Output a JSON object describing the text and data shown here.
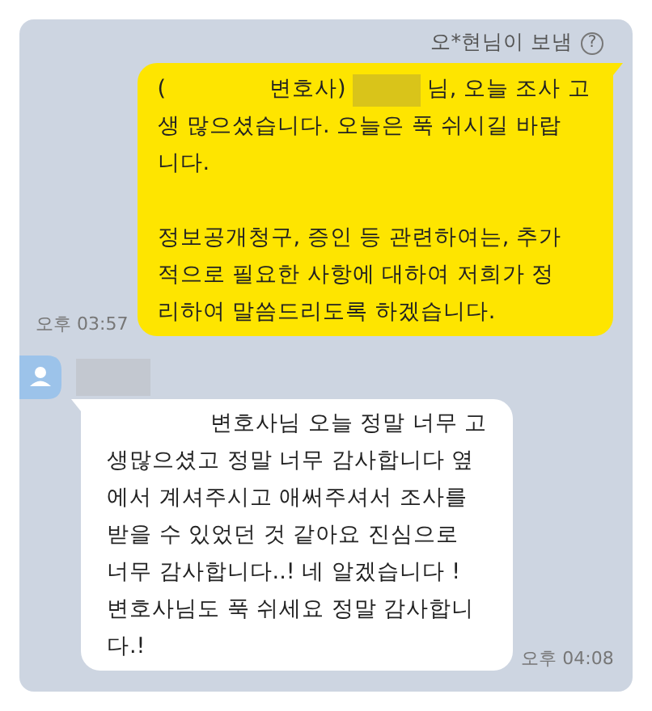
{
  "header": {
    "sender_note": "오*현님이 보냄",
    "help_icon": "?"
  },
  "messages": [
    {
      "kind": "outgoing",
      "time": "오후 03:57",
      "paragraphs": [
        [
          [
            {
              "kind": "text",
              "text": "("
            },
            {
              "kind": "blank"
            },
            {
              "kind": "text",
              "text": "변호사)"
            },
            {
              "kind": "redacted"
            },
            {
              "kind": "text",
              "text": "님, 오늘 조사 고"
            }
          ],
          [
            {
              "kind": "text",
              "text": "생 많으셨습니다. 오늘은 푹 쉬시길 바랍"
            }
          ],
          [
            {
              "kind": "text",
              "text": "니다."
            }
          ]
        ],
        [
          [
            {
              "kind": "text",
              "text": "정보공개청구, 증인 등 관련하여는, 추가"
            }
          ],
          [
            {
              "kind": "text",
              "text": "적으로 필요한 사항에 대하여 저희가 정"
            }
          ],
          [
            {
              "kind": "text",
              "text": "리하여 말씀드리도록 하겠습니다."
            }
          ]
        ]
      ]
    },
    {
      "kind": "incoming",
      "time": "오후 04:08",
      "paragraphs": [
        [
          [
            {
              "kind": "blank"
            },
            {
              "kind": "text",
              "text": "변호사님 오늘 정말 너무 고"
            }
          ],
          [
            {
              "kind": "text",
              "text": "생많으셨고 정말 너무 감사합니다 옆"
            }
          ],
          [
            {
              "kind": "text",
              "text": "에서 계셔주시고 애써주셔서 조사를"
            }
          ],
          [
            {
              "kind": "text",
              "text": "받을 수 있었던 것 같아요 진심으로"
            }
          ],
          [
            {
              "kind": "text",
              "text": "너무 감사합니다..! 네 알겠습니다 !"
            }
          ],
          [
            {
              "kind": "text",
              "text": "변호사님도 푹 쉬세요 정말 감사합니"
            }
          ],
          [
            {
              "kind": "text",
              "text": "다.!"
            }
          ]
        ]
      ]
    }
  ]
}
